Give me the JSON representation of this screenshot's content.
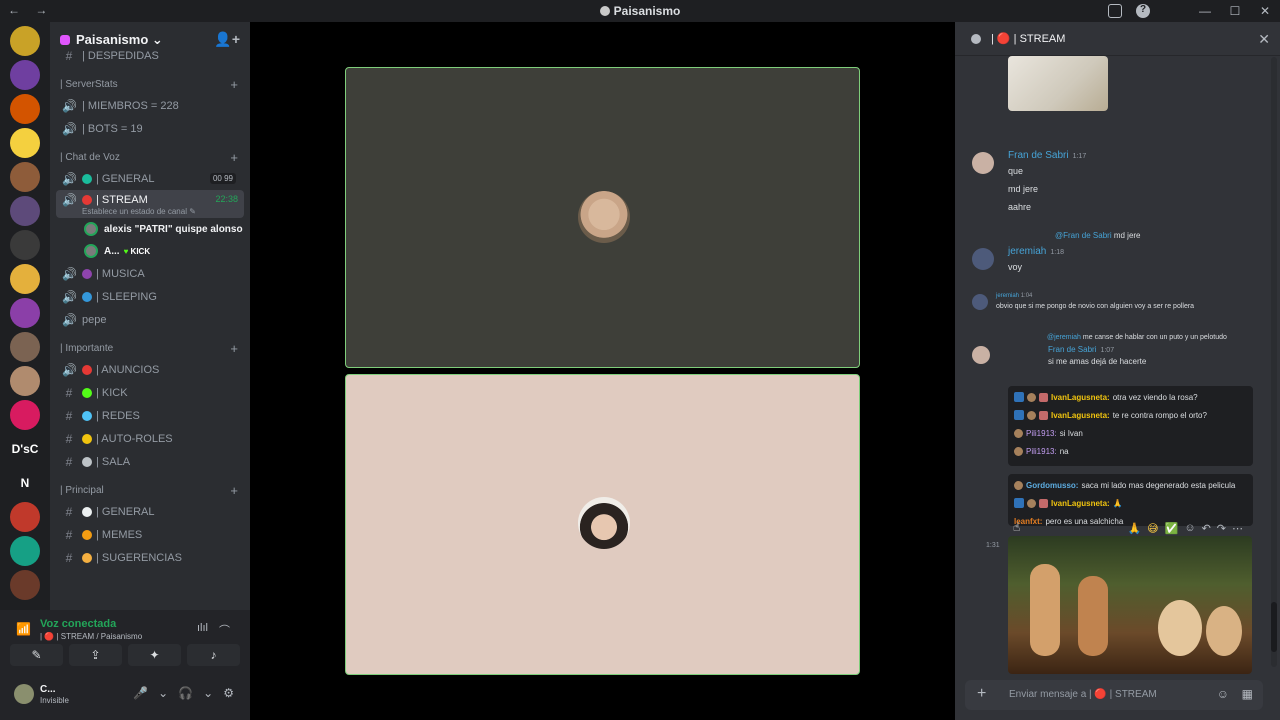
{
  "window": {
    "title": "Paisanismo",
    "nav_glyphs": "← →",
    "help_glyph": "?",
    "min_glyph": "—",
    "max_glyph": "☐",
    "close_glyph": "✕"
  },
  "guilds": {
    "text_items": [
      "D'sC",
      "N"
    ],
    "add_glyph": "+",
    "colors": [
      "#c9a227",
      "#6f3fa0",
      "#d35400",
      "#f4d03f",
      "#8e5c3a",
      "#5d4a7a",
      "#3a3a3a",
      "#e4b03c",
      "#8b3fa8",
      "#7b6352",
      "#b08b6e",
      "#d81b60"
    ],
    "colors_after": [
      "#c0392b",
      "#16a085",
      "#6a3a2a"
    ]
  },
  "server": {
    "name": "Paisanismo",
    "chevron": "⌄",
    "invite_glyph": "👤+"
  },
  "categories": {
    "serverstats": "| ServerStats",
    "chat_de_voz": "| Chat de Voz",
    "importante": "| Importante",
    "principal": "| Principal",
    "plus_glyph": "+"
  },
  "channels": {
    "despedidas": "| DESPEDIDAS",
    "miembros": "| MIEMBROS = 228",
    "bots": "| BOTS = 19",
    "general_voice": "| GENERAL",
    "general_voice_badges": "00  99",
    "stream": "| STREAM",
    "stream_time": "22:38",
    "stream_sub": "Establece un estado de canal ✎",
    "musica": "| MUSICA",
    "sleeping": "| SLEEPING",
    "pepe": "pepe",
    "anuncios": "| ANUNCIOS",
    "kick": "| KICK",
    "redes": "| REDES",
    "autoroles": "| AUTO-ROLES",
    "sala": "| SALA",
    "general_text": "| GENERAL",
    "memes": "| MEMES",
    "sugerencias": "| SUGERENCIAS",
    "voice_icon": "🔊",
    "hash_icon": "#"
  },
  "voice_users": {
    "user1": "alexis \"PATRI\" quispe alonso",
    "user2": "A...",
    "user2_badge": "KICK"
  },
  "voice_panel": {
    "title": "Voz conectada",
    "subtitle": "| 🔴 | STREAM / Paisanismo",
    "noise_glyph": "ılıl",
    "disconnect_glyph": "⌒",
    "signal_glyph": "📶"
  },
  "action_buttons": {
    "camera": "✎",
    "share": "⇪",
    "activities": "✦",
    "soundboard": "♪"
  },
  "user": {
    "name": "C...",
    "status": "Invisible",
    "mic_glyph": "🎤",
    "headset_glyph": "🎧",
    "settings_glyph": "⚙",
    "chevron": "⌄"
  },
  "chat": {
    "header": "| 🔴 | STREAM",
    "close_glyph": "✕",
    "msg1_author": "Fran de Sabri",
    "msg1_time": "1:17",
    "msg1_lines": [
      "que",
      "md jere",
      "aahre"
    ],
    "msg2_reply_mention": "@Fran de Sabri",
    "msg2_reply_text": "md jere",
    "msg2_author": "jeremiah",
    "msg2_time": "1:18",
    "msg2_line": "voy",
    "msg3_author": "jeremiah",
    "msg3_time": "1:04",
    "msg3_line": "obvio que si me pongo de novio con alguien voy a ser re pollera",
    "msg4_reply_mention": "@jeremiah",
    "msg4_reply_text": "me canse de hablar con un puto y un pelotudo",
    "msg4_author": "Fran de Sabri",
    "msg4_time": "1:07",
    "msg4_line": "si me amas dejá de hacerte",
    "embed1": [
      {
        "user": "IvanLagusneta:",
        "text": "otra vez viendo la rosa?"
      },
      {
        "user": "IvanLagusneta:",
        "text": "te re contra rompo el orto?"
      },
      {
        "user": "Pili1913:",
        "text": "si Ivan"
      },
      {
        "user": "Pili1913:",
        "text": "na"
      }
    ],
    "embed2": [
      {
        "user": "Gordomusso:",
        "text": "saca mi lado mas degenerado esta pelicula"
      },
      {
        "user": "IvanLagusneta:",
        "text": "🙏"
      },
      {
        "user": "leanfxt:",
        "text": "pero es una salchicha"
      }
    ],
    "gif_time": "1:31",
    "hover_glyphs": [
      "🙏",
      "😅",
      "✅",
      "☺",
      "↶",
      "↷",
      "⋯"
    ],
    "composer_placeholder": "Enviar mensaje a | 🔴 | STREAM",
    "composer_plus": "+",
    "composer_emoji": "☺",
    "composer_apps": "▦",
    "cursor_glyph": "☝"
  },
  "colors": {
    "accent_green": "#23a559",
    "mention_blue": "#46a3d6",
    "tile_border": "#7fce7b"
  }
}
